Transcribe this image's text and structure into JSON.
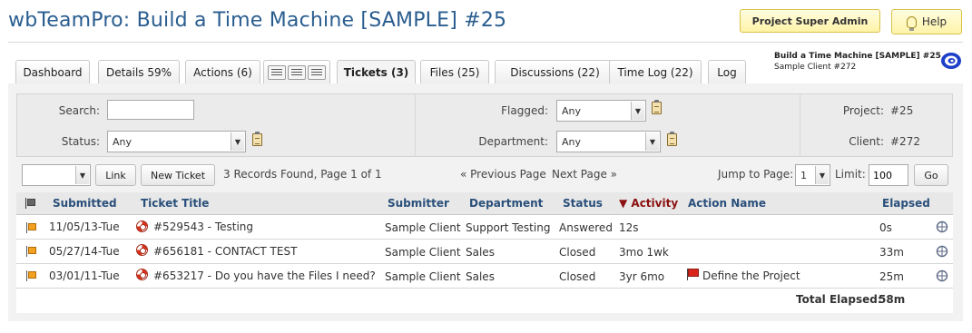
{
  "page_title": "wbTeamPro: Build a Time Machine [SAMPLE] #25",
  "header": {
    "admin_label": "Project Super Admin",
    "help_label": "Help",
    "project_name": "Build a Time Machine [SAMPLE] #25",
    "client_name": "Sample Client #272"
  },
  "tabs": [
    {
      "label": "Dashboard"
    },
    {
      "label": "Details 59%"
    },
    {
      "label": "Actions (6)"
    },
    {
      "label": "Tickets (3)"
    },
    {
      "label": "Files (25)"
    },
    {
      "label": "Discussions (22)"
    },
    {
      "label": "Time Log (22)"
    },
    {
      "label": "Log"
    }
  ],
  "filters": {
    "search_label": "Search:",
    "search_value": "",
    "status_label": "Status:",
    "status_value": "Any",
    "flagged_label": "Flagged:",
    "flagged_value": "Any",
    "department_label": "Department:",
    "department_value": "Any",
    "project_label": "Project:",
    "project_value": "#25",
    "client_label": "Client:",
    "client_value": "#272"
  },
  "toolbar": {
    "action_select_value": "",
    "link_label": "Link",
    "new_ticket_label": "New Ticket",
    "records_text": "3 Records Found, Page 1 of 1",
    "prev_label": "« Previous Page",
    "next_label": "Next Page »",
    "jump_label": "Jump to Page:",
    "jump_value": "1",
    "limit_label": "Limit:",
    "limit_value": "100",
    "go_label": "Go"
  },
  "table": {
    "headers": {
      "submitted": "Submitted",
      "title": "Ticket Title",
      "submitter": "Submitter",
      "department": "Department",
      "status": "Status",
      "activity": "▼ Activity",
      "action_name": "Action Name",
      "elapsed": "Elapsed"
    },
    "rows": [
      {
        "submitted": "11/05/13-Tue",
        "title": "#529543 - Testing",
        "submitter": "Sample Client",
        "department": "Support Testing",
        "status": "Answered",
        "activity": "12s",
        "action_name": "",
        "elapsed": "0s"
      },
      {
        "submitted": "05/27/14-Tue",
        "title": "#656181 - CONTACT TEST",
        "submitter": "Sample Client",
        "department": "Sales",
        "status": "Closed",
        "activity": "3mo 1wk",
        "action_name": "",
        "elapsed": "33m"
      },
      {
        "submitted": "03/01/11-Tue",
        "title": "#653217 - Do you have the Files I need?",
        "submitter": "Sample Client",
        "department": "Sales",
        "status": "Closed",
        "activity": "3yr 6mo",
        "action_name": "Define the Project",
        "elapsed": "25m"
      }
    ],
    "total_label": "Total Elapsed:",
    "total_value": "58m"
  },
  "icons": [
    "lightbulb-icon",
    "clipboard-icon",
    "flag-icon",
    "lifebuoy-icon",
    "red-flag-icon",
    "edit-icon",
    "project-logo-icon"
  ],
  "colors": {
    "title": "#2a5d8f",
    "header_text": "#2a4f7a",
    "sorted_header": "#8b1010",
    "flag_orange": "#f2a01e",
    "admin_bg": "#fff3a8"
  }
}
